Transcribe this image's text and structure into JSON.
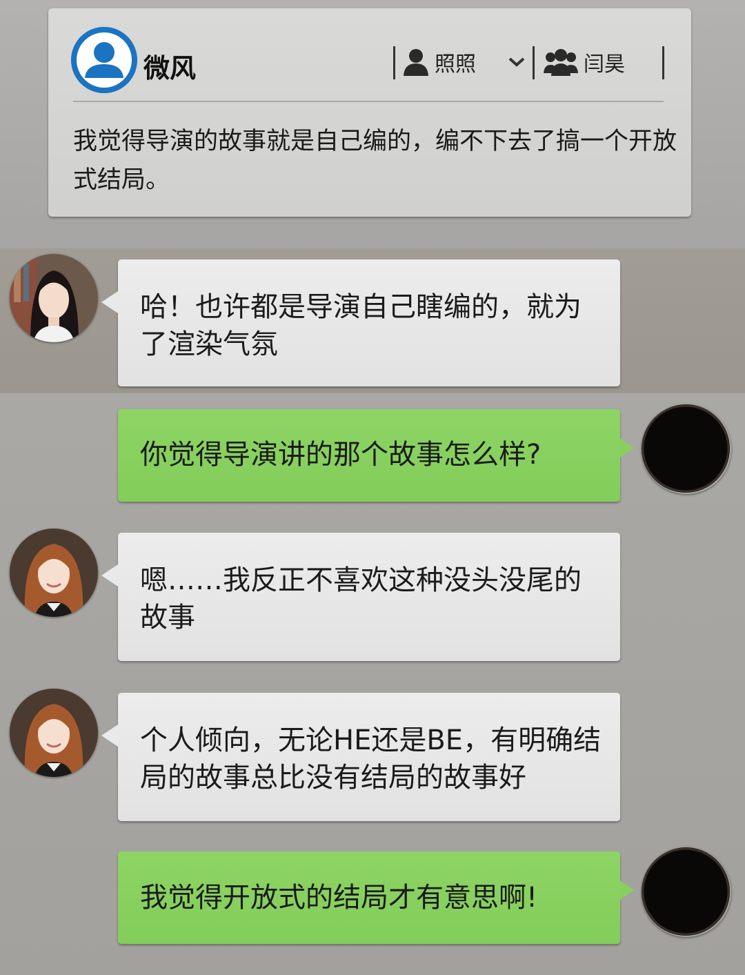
{
  "colors": {
    "page_bg": "#a9a7a3",
    "card_bg": "#d6d6d5",
    "bubble_white": "#e8e8e8",
    "bubble_green": "#88d05e",
    "avatar_blue": "#1b73c2"
  },
  "post": {
    "author": "微风",
    "avatar_icon": "user-icon",
    "mentions": [
      {
        "name": "照照",
        "icon": "person-icon"
      },
      {
        "name": "闫昊",
        "icon": "group-icon"
      }
    ],
    "chevron_icon": "chevron-down-icon",
    "text": "我觉得导演的故事就是自己编的，编不下去了搞一个开放式结局。"
  },
  "messages": [
    {
      "side": "left",
      "avatar": "avatar-dark-hair-woman",
      "text": "哈！也许都是导演自己瞎编的，就为了渲染气氛"
    },
    {
      "side": "right",
      "avatar": "avatar-black-circle",
      "text": "你觉得导演讲的那个故事怎么样?"
    },
    {
      "side": "left",
      "avatar": "avatar-auburn-hair-woman",
      "text": "嗯……我反正不喜欢这种没头没尾的故事"
    },
    {
      "side": "left",
      "avatar": "avatar-auburn-hair-woman",
      "text": "个人倾向，无论HE还是BE，有明确结局的故事总比没有结局的故事好"
    },
    {
      "side": "right",
      "avatar": "avatar-black-circle",
      "text": "我觉得开放式的结局才有意思啊!"
    }
  ]
}
